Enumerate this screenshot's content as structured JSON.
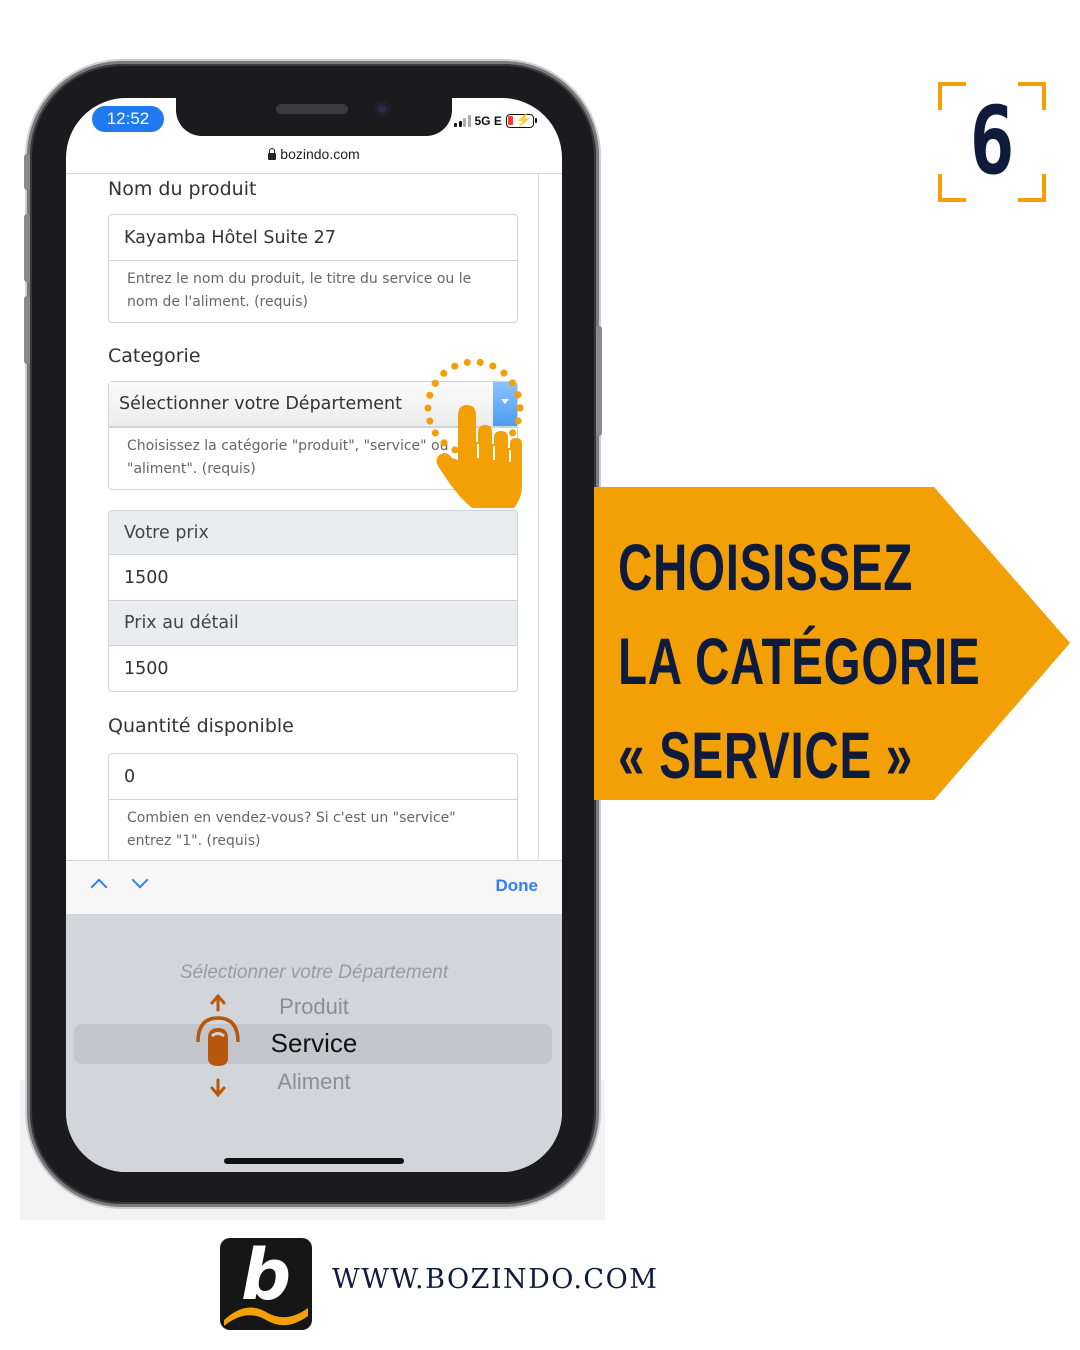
{
  "status_bar": {
    "time": "12:52",
    "network": "5G E"
  },
  "browser": {
    "url": "bozindo.com"
  },
  "form": {
    "product_name": {
      "label": "Nom du produit",
      "value": "Kayamba Hôtel Suite 27",
      "help": "Entrez le nom du produit, le titre du service ou le nom de l'aliment. (requis)"
    },
    "category": {
      "label": "Categorie",
      "selected": "Sélectionner votre Département",
      "help": "Choisissez la catégorie \"produit\", \"service\" ou \"aliment\". (requis)"
    },
    "price": {
      "label": "Votre prix",
      "value": "1500"
    },
    "retail_price": {
      "label": "Prix au détail",
      "value": "1500"
    },
    "quantity": {
      "label": "Quantité disponible",
      "value": "0",
      "help": "Combien en vendez-vous? Si c'est un \"service\" entrez \"1\". (requis)"
    }
  },
  "keyboard_accessory": {
    "done_label": "Done"
  },
  "picker": {
    "options": [
      "Sélectionner votre Département",
      "Produit",
      "Service",
      "Aliment"
    ],
    "selected": "Service"
  },
  "step": {
    "number": "6"
  },
  "banner": {
    "lines": [
      "CHOISISSEZ",
      "LA CATÉGORIE",
      "« SERVICE »"
    ]
  },
  "footer": {
    "logo_letter": "b",
    "website": "WWW.BOZINDO.COM"
  },
  "colors": {
    "accent": "#f2a006",
    "navy": "#0f1b3d",
    "ios_blue": "#2f7ff5"
  }
}
